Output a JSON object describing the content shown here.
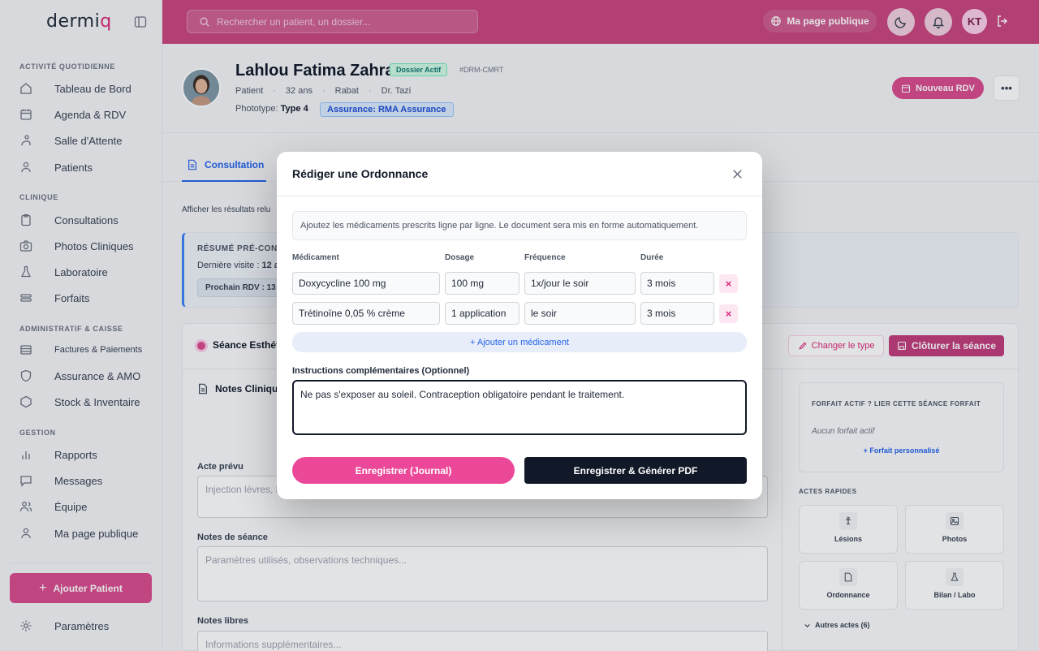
{
  "app": {
    "logo_main": "dermi",
    "logo_accent": "q"
  },
  "sidebar": {
    "sections": [
      {
        "title": "ACTIVITÉ QUOTIDIENNE"
      },
      {
        "title": "CLINIQUE"
      },
      {
        "title": "ADMINISTRATIF & CAISSE"
      },
      {
        "title": "GESTION"
      }
    ],
    "items": [
      {
        "label": "Tableau de Bord",
        "icon": "home-icon"
      },
      {
        "label": "Agenda & RDV",
        "icon": "calendar-icon"
      },
      {
        "label": "Salle d'Attente",
        "icon": "waiting-room-icon"
      },
      {
        "label": "Patients",
        "icon": "user-icon"
      },
      {
        "label": "Consultations",
        "icon": "clipboard-icon"
      },
      {
        "label": "Photos Cliniques",
        "icon": "camera-icon"
      },
      {
        "label": "Laboratoire",
        "icon": "flask-icon"
      },
      {
        "label": "Forfaits",
        "icon": "layers-icon"
      },
      {
        "label": "Factures & Paiements",
        "icon": "invoice-icon"
      },
      {
        "label": "Assurance & AMO",
        "icon": "shield-icon"
      },
      {
        "label": "Stock & Inventaire",
        "icon": "box-icon"
      },
      {
        "label": "Rapports",
        "icon": "bar-chart-icon"
      },
      {
        "label": "Messages",
        "icon": "message-icon"
      },
      {
        "label": "Équipe",
        "icon": "team-icon"
      },
      {
        "label": "Ma page publique",
        "icon": "user-icon"
      }
    ],
    "add_patient": "Ajouter Patient",
    "settings": "Paramètres"
  },
  "topbar": {
    "search_placeholder": "Rechercher un patient, un dossier...",
    "public_page": "Ma page publique",
    "avatar_initials": "KT"
  },
  "patient": {
    "name": "Lahlou Fatima Zahra",
    "status": "Dossier Actif",
    "id": "#DRM-CMRT",
    "role": "Patient",
    "age": "32 ans",
    "city": "Rabat",
    "doctor": "Dr. Tazi",
    "phototype_label": "Phototype:",
    "phototype_value": "Type 4",
    "insurance": "Assurance: RMA Assurance",
    "new_rdv": "Nouveau RDV"
  },
  "tabs": {
    "consultation": "Consultation"
  },
  "page": {
    "show_results": "Afficher les résultats relu",
    "resume_title": "RÉSUMÉ PRÉ-CONS",
    "last_visit": "Dernière visite :",
    "last_visit_value": "12 a",
    "next_rdv": "Prochain RDV : 13 a"
  },
  "seance": {
    "title": "Séance Esthét",
    "change_type": "Changer le type",
    "close": "Clôturer la séance",
    "notes_title": "Notes Clinique",
    "acte_label": "Acte prévu",
    "acte_value": "Injection lèvres, l",
    "notes_label": "Notes de séance",
    "notes_placeholder": "Paramètres utilisés, observations techniques...",
    "free_label": "Notes libres",
    "free_placeholder": "Informations supplémentaires...",
    "forfait_title": "FORFAIT ACTIF ? LIER CETTE SÉANCE FORFAIT",
    "forfait_none": "Aucun forfait actif",
    "forfait_custom": "+ Forfait personnalisé",
    "quick_title": "ACTES RAPIDES",
    "quick": [
      {
        "label": "Lésions",
        "icon": "figure-icon"
      },
      {
        "label": "Photos",
        "icon": "image-icon"
      },
      {
        "label": "Ordonnance",
        "icon": "document-icon"
      },
      {
        "label": "Bilan / Labo",
        "icon": "flask-icon"
      }
    ],
    "more_acts": "Autres actes (6)"
  },
  "modal": {
    "title": "Rédiger une Ordonnance",
    "info": "Ajoutez les médicaments prescrits ligne par ligne. Le document sera mis en forme automatiquement.",
    "columns": {
      "med": "Médicament",
      "dose": "Dosage",
      "freq": "Fréquence",
      "dur": "Durée"
    },
    "rows": [
      {
        "med": "Doxycycline 100 mg",
        "dose": "100 mg",
        "freq": "1x/jour le soir",
        "dur": "3 mois"
      },
      {
        "med": "Trétinoïne 0,05 % crème",
        "dose": "1 application",
        "freq": "le soir",
        "dur": "3 mois"
      }
    ],
    "add_med": "+ Ajouter un médicament",
    "instr_label": "Instructions complémentaires (Optionnel)",
    "instr_value": "Ne pas s'exposer au soleil. Contraception obligatoire pendant le traitement.",
    "save_journal": "Enregistrer (Journal)",
    "save_pdf": "Enregistrer & Générer PDF"
  },
  "colors": {
    "brand": "#c9467f",
    "accent": "#ec4899",
    "link": "#2563eb",
    "dark": "#111827"
  }
}
